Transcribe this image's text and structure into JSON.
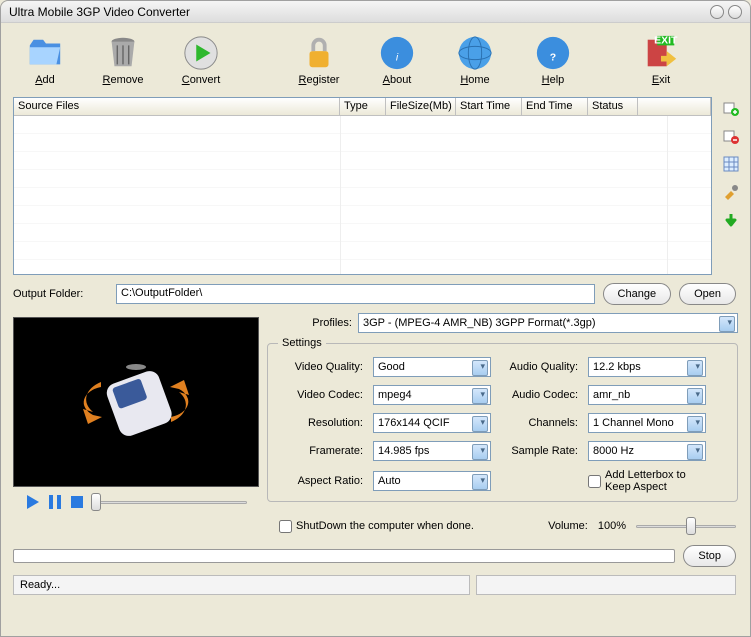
{
  "title": "Ultra Mobile 3GP Video Converter",
  "toolbar": {
    "add": "Add",
    "remove": "Remove",
    "convert": "Convert",
    "register": "Register",
    "about": "About",
    "home": "Home",
    "help": "Help",
    "exit": "Exit"
  },
  "grid": {
    "cols": [
      "Source Files",
      "Type",
      "FileSize(Mb)",
      "Start Time",
      "End Time",
      "Status"
    ]
  },
  "output": {
    "label": "Output Folder:",
    "path": "C:\\OutputFolder\\",
    "change": "Change",
    "open": "Open"
  },
  "profiles": {
    "label": "Profiles:",
    "value": "3GP - (MPEG-4 AMR_NB) 3GPP Format(*.3gp)"
  },
  "settings": {
    "legend": "Settings",
    "video_quality_l": "Video Quality:",
    "video_quality_v": "Good",
    "audio_quality_l": "Audio Quality:",
    "audio_quality_v": "12.2  kbps",
    "video_codec_l": "Video Codec:",
    "video_codec_v": "mpeg4",
    "audio_codec_l": "Audio Codec:",
    "audio_codec_v": "amr_nb",
    "resolution_l": "Resolution:",
    "resolution_v": "176x144 QCIF",
    "channels_l": "Channels:",
    "channels_v": "1 Channel Mono",
    "framerate_l": "Framerate:",
    "framerate_v": "14.985 fps",
    "samplerate_l": "Sample Rate:",
    "samplerate_v": "8000 Hz",
    "aspect_l": "Aspect Ratio:",
    "aspect_v": "Auto",
    "letterbox": "Add Letterbox to Keep Aspect"
  },
  "shutdown": "ShutDown the computer when done.",
  "volume": {
    "label": "Volume:",
    "value": "100%"
  },
  "stop": "Stop",
  "status": "Ready..."
}
